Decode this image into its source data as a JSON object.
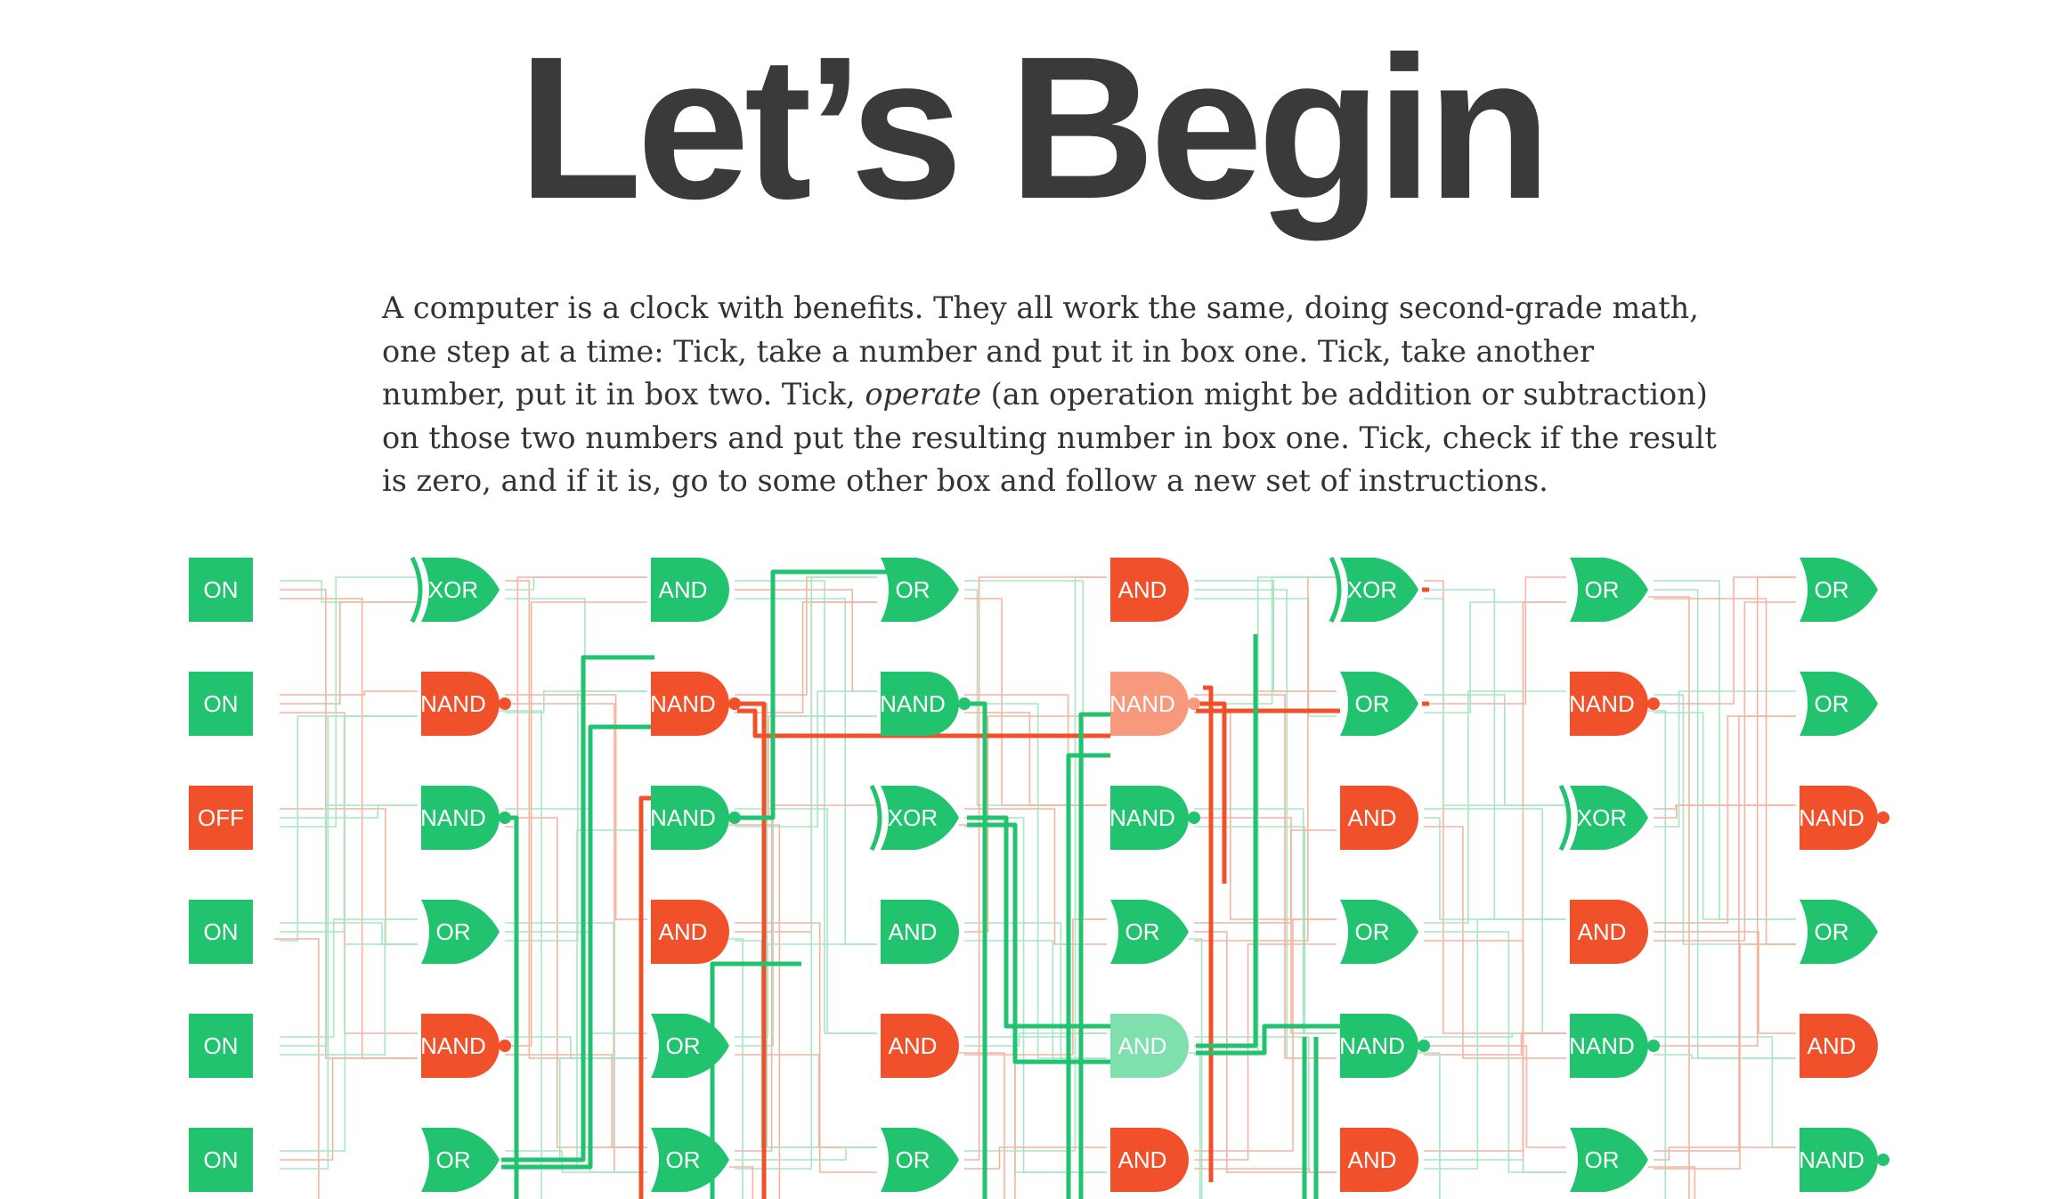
{
  "title": "Let’s Begin",
  "intro": {
    "before": "A computer is a clock with benefits. They all work the same, doing second-grade math, one step at a time: Tick, take a number and put it in box one. Tick, take another number, put it in box two. Tick, ",
    "emphasis": "operate",
    "after": " (an operation might be addition or subtraction) on those two numbers and put the resulting number in box one. Tick, check if the result is zero, and if it is, go to some other box and follow a new set of instructions."
  },
  "colors": {
    "green": "#21c36f",
    "red": "#f0502a",
    "pale_red": "#f7997c",
    "pale_green": "#7fdfad",
    "wire_green": "#a6e6c3",
    "wire_red": "#f6b3a0",
    "text": "#333333"
  },
  "circuit": {
    "columns": [
      {
        "gates": [
          {
            "type": "ON",
            "label": "ON",
            "state": "on",
            "bubble": false
          },
          {
            "type": "ON",
            "label": "ON",
            "state": "on",
            "bubble": false
          },
          {
            "type": "OFF",
            "label": "OFF",
            "state": "off",
            "bubble": false
          },
          {
            "type": "ON",
            "label": "ON",
            "state": "on",
            "bubble": false
          },
          {
            "type": "ON",
            "label": "ON",
            "state": "on",
            "bubble": false
          },
          {
            "type": "ON",
            "label": "ON",
            "state": "on",
            "bubble": false
          }
        ]
      },
      {
        "gates": [
          {
            "type": "XOR",
            "label": "XOR",
            "state": "on",
            "bubble": false
          },
          {
            "type": "NAND",
            "label": "NAND",
            "state": "off",
            "bubble": true
          },
          {
            "type": "NAND",
            "label": "NAND",
            "state": "on",
            "bubble": true
          },
          {
            "type": "OR",
            "label": "OR",
            "state": "on",
            "bubble": false
          },
          {
            "type": "NAND",
            "label": "NAND",
            "state": "off",
            "bubble": true
          },
          {
            "type": "OR",
            "label": "OR",
            "state": "on",
            "bubble": false
          }
        ]
      },
      {
        "gates": [
          {
            "type": "AND",
            "label": "AND",
            "state": "on",
            "bubble": false
          },
          {
            "type": "NAND",
            "label": "NAND",
            "state": "off",
            "bubble": true
          },
          {
            "type": "NAND",
            "label": "NAND",
            "state": "on",
            "bubble": true
          },
          {
            "type": "AND",
            "label": "AND",
            "state": "off",
            "bubble": false
          },
          {
            "type": "OR",
            "label": "OR",
            "state": "on",
            "bubble": false
          },
          {
            "type": "OR",
            "label": "OR",
            "state": "on",
            "bubble": false
          }
        ]
      },
      {
        "gates": [
          {
            "type": "OR",
            "label": "OR",
            "state": "on",
            "bubble": false
          },
          {
            "type": "NAND",
            "label": "NAND",
            "state": "on",
            "bubble": true
          },
          {
            "type": "XOR",
            "label": "XOR",
            "state": "on",
            "bubble": false
          },
          {
            "type": "AND",
            "label": "AND",
            "state": "on",
            "bubble": false
          },
          {
            "type": "AND",
            "label": "AND",
            "state": "off",
            "bubble": false
          },
          {
            "type": "OR",
            "label": "OR",
            "state": "on",
            "bubble": false
          }
        ]
      },
      {
        "gates": [
          {
            "type": "AND",
            "label": "AND",
            "state": "off",
            "bubble": false
          },
          {
            "type": "NAND",
            "label": "NAND",
            "state": "pale-off",
            "bubble": true
          },
          {
            "type": "NAND",
            "label": "NAND",
            "state": "on",
            "bubble": true
          },
          {
            "type": "OR",
            "label": "OR",
            "state": "on",
            "bubble": false
          },
          {
            "type": "AND",
            "label": "AND",
            "state": "pale-on",
            "bubble": false
          },
          {
            "type": "AND",
            "label": "AND",
            "state": "off",
            "bubble": false
          }
        ]
      },
      {
        "gates": [
          {
            "type": "XOR",
            "label": "XOR",
            "state": "on",
            "bubble": false
          },
          {
            "type": "OR",
            "label": "OR",
            "state": "on",
            "bubble": false
          },
          {
            "type": "AND",
            "label": "AND",
            "state": "off",
            "bubble": false
          },
          {
            "type": "OR",
            "label": "OR",
            "state": "on",
            "bubble": false
          },
          {
            "type": "NAND",
            "label": "NAND",
            "state": "on",
            "bubble": true
          },
          {
            "type": "AND",
            "label": "AND",
            "state": "off",
            "bubble": false
          }
        ]
      },
      {
        "gates": [
          {
            "type": "OR",
            "label": "OR",
            "state": "on",
            "bubble": false
          },
          {
            "type": "NAND",
            "label": "NAND",
            "state": "off",
            "bubble": true
          },
          {
            "type": "XOR",
            "label": "XOR",
            "state": "on",
            "bubble": false
          },
          {
            "type": "AND",
            "label": "AND",
            "state": "off",
            "bubble": false
          },
          {
            "type": "NAND",
            "label": "NAND",
            "state": "on",
            "bubble": true
          },
          {
            "type": "OR",
            "label": "OR",
            "state": "on",
            "bubble": false
          }
        ]
      },
      {
        "gates": [
          {
            "type": "OR",
            "label": "OR",
            "state": "on",
            "bubble": false
          },
          {
            "type": "OR",
            "label": "OR",
            "state": "on",
            "bubble": false
          },
          {
            "type": "NAND",
            "label": "NAND",
            "state": "off",
            "bubble": true
          },
          {
            "type": "OR",
            "label": "OR",
            "state": "on",
            "bubble": false
          },
          {
            "type": "AND",
            "label": "AND",
            "state": "off",
            "bubble": false
          },
          {
            "type": "NAND",
            "label": "NAND",
            "state": "on",
            "bubble": true
          }
        ]
      }
    ]
  }
}
